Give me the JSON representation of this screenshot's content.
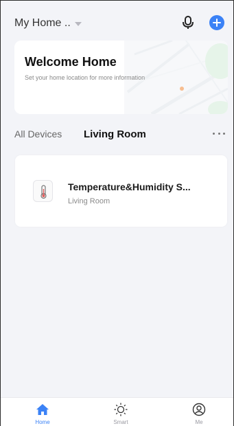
{
  "header": {
    "home_name": "My Home ..",
    "icons": [
      "microphone-icon",
      "add-icon"
    ]
  },
  "welcome": {
    "title": "Welcome Home",
    "subtitle": "Set your home location for more information"
  },
  "tabs": {
    "all_devices": "All Devices",
    "active_room": "Living Room"
  },
  "device": {
    "name": "Temperature&Humidity S...",
    "room": "Living Room",
    "icon": "thermometer-icon"
  },
  "bottom_nav": {
    "items": [
      {
        "label": "Home",
        "icon": "home-icon",
        "active": true
      },
      {
        "label": "Smart",
        "icon": "sun-icon",
        "active": false
      },
      {
        "label": "Me",
        "icon": "profile-icon",
        "active": false
      }
    ]
  },
  "colors": {
    "accent": "#3b82f6",
    "background": "#f3f4f8",
    "card": "#ffffff"
  }
}
